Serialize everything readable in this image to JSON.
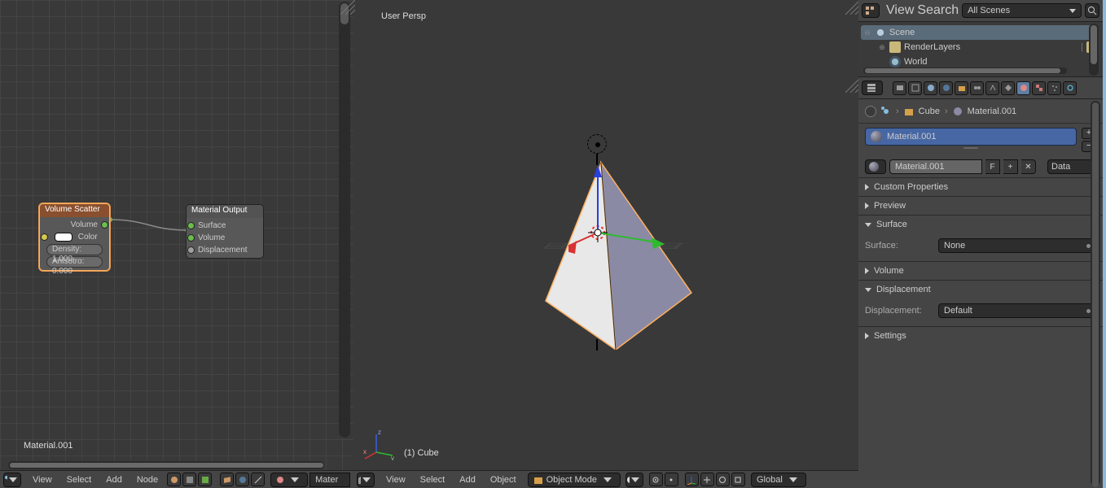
{
  "nodeEditor": {
    "materialName": "Material.001",
    "menus": {
      "view": "View",
      "select": "Select",
      "add": "Add",
      "node": "Node"
    },
    "toolPill": "Mater",
    "node1": {
      "title": "Volume Scatter",
      "outVolume": "Volume",
      "color": "Color",
      "density": "Density: 1.000",
      "aniso": "Anisotro: 0.000"
    },
    "node2": {
      "title": "Material Output",
      "surface": "Surface",
      "volume": "Volume",
      "disp": "Displacement"
    }
  },
  "viewport": {
    "persp": "User Persp",
    "objLabel": "(1) Cube",
    "menus": {
      "view": "View",
      "select": "Select",
      "add": "Add",
      "object": "Object"
    },
    "mode": "Object Mode",
    "orient": "Global"
  },
  "outliner": {
    "menus": {
      "view": "View",
      "search": "Search"
    },
    "scenesLabel": "All Scenes",
    "scene": "Scene",
    "layers": "RenderLayers",
    "world": "World"
  },
  "props": {
    "crumb": {
      "obj": "Cube",
      "mat": "Material.001"
    },
    "matSlot": "Material.001",
    "matName": "Material.001",
    "fBtn": "F",
    "plusBtn": "+",
    "xBtn": "✕",
    "dataToggle": "Data",
    "panels": {
      "custom": "Custom Properties",
      "preview": "Preview",
      "surface": "Surface",
      "surfaceLabel": "Surface:",
      "surfaceValue": "None",
      "volume": "Volume",
      "disp": "Displacement",
      "dispLabel": "Displacement:",
      "dispValue": "Default",
      "settings": "Settings"
    }
  }
}
